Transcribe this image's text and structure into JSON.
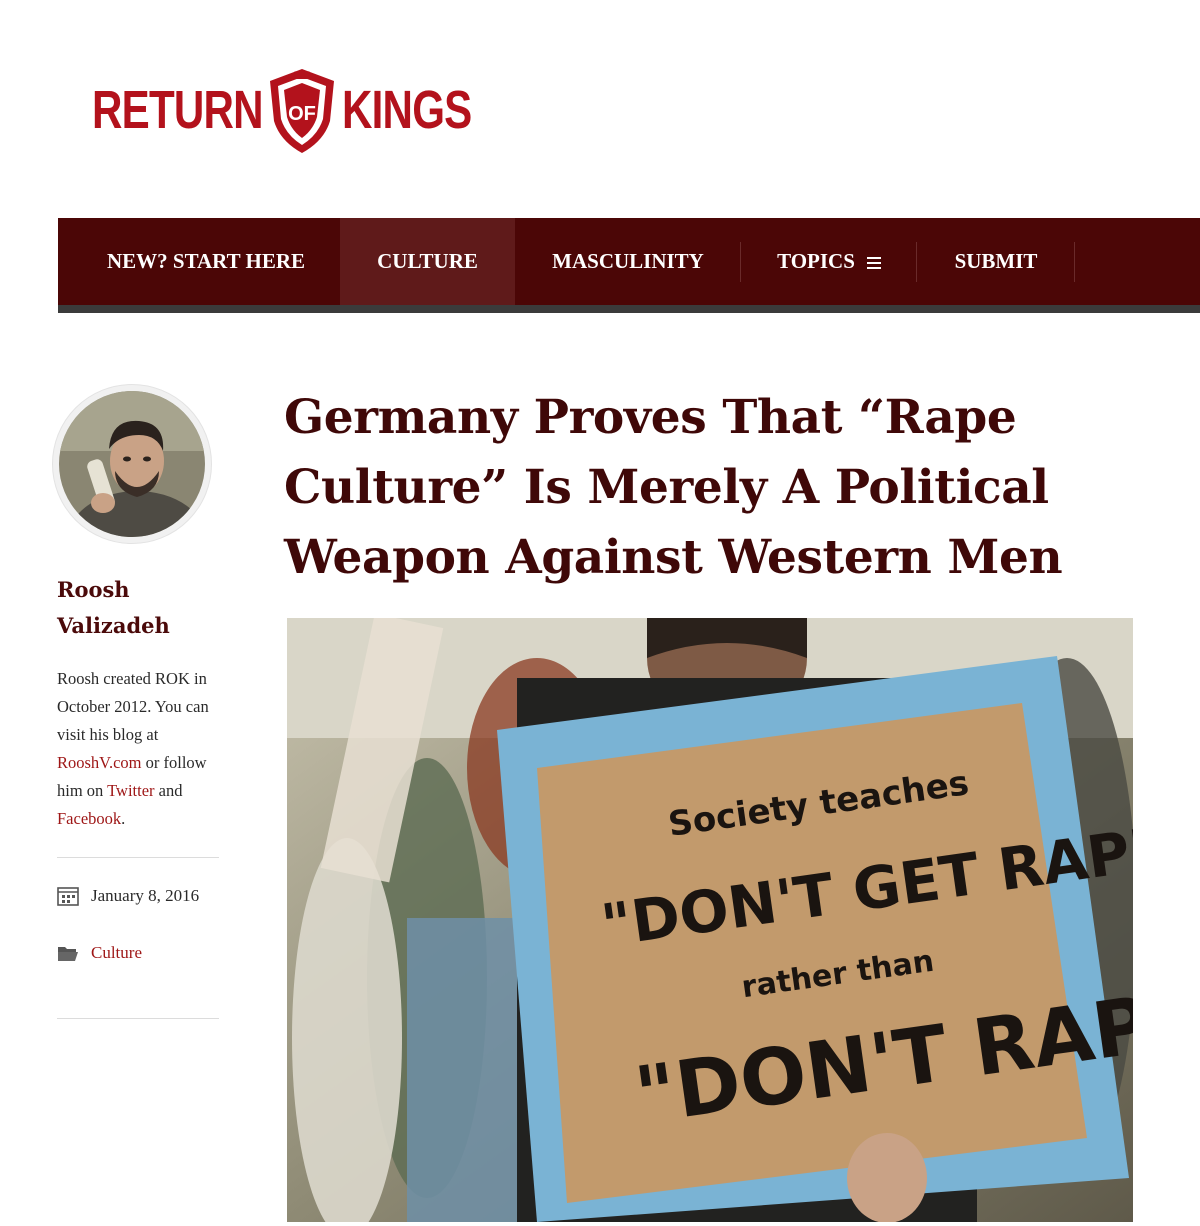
{
  "site": {
    "logo_left": "RETURN",
    "logo_middle": "OF",
    "logo_right": "KINGS",
    "brand_color": "#b3121c",
    "nav_color": "#4b0606"
  },
  "nav": {
    "items": [
      {
        "label": "NEW? START HERE"
      },
      {
        "label": "CULTURE"
      },
      {
        "label": "MASCULINITY"
      },
      {
        "label": "TOPICS"
      },
      {
        "label": "SUBMIT"
      }
    ],
    "active": "CULTURE",
    "topics_icon": "menu-icon"
  },
  "author": {
    "first_name": "Roosh",
    "last_name": "Valizadeh",
    "bio_prefix": "Roosh created ROK in October 2012. You can visit his blog at ",
    "bio_link1": "RooshV.com",
    "bio_middle": " or follow him on ",
    "bio_link2": "Twitter",
    "bio_and": " and ",
    "bio_link3": "Facebook",
    "bio_end": "."
  },
  "meta": {
    "date": "January 8, 2016",
    "date_icon": "calendar-icon",
    "category": "Culture",
    "category_icon": "folder-icon"
  },
  "article": {
    "title": "Germany Proves That “Rape Culture” Is Merely A Political Weapon Against Western Men",
    "image_sign": {
      "line1": "Society teaches",
      "line2": "\"DON'T GET RAPED\"",
      "line3": "rather than",
      "line4": "\"DON'T RAPE\""
    }
  }
}
